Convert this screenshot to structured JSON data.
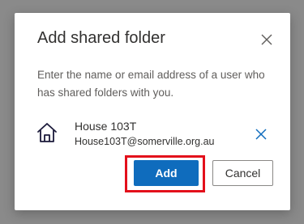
{
  "dialog": {
    "title": "Add shared folder",
    "description": "Enter the name or email address of a user who has shared folders with you.",
    "close_icon": "close-icon"
  },
  "user": {
    "name": "House 103T",
    "email": "House103T@somerville.org.au",
    "icon": "home-icon",
    "remove_icon": "remove-x-icon"
  },
  "actions": {
    "add_label": "Add",
    "cancel_label": "Cancel"
  },
  "colors": {
    "accent": "#0f6cbd",
    "highlight": "#e3101b",
    "backdrop": "#8a8a8a"
  }
}
